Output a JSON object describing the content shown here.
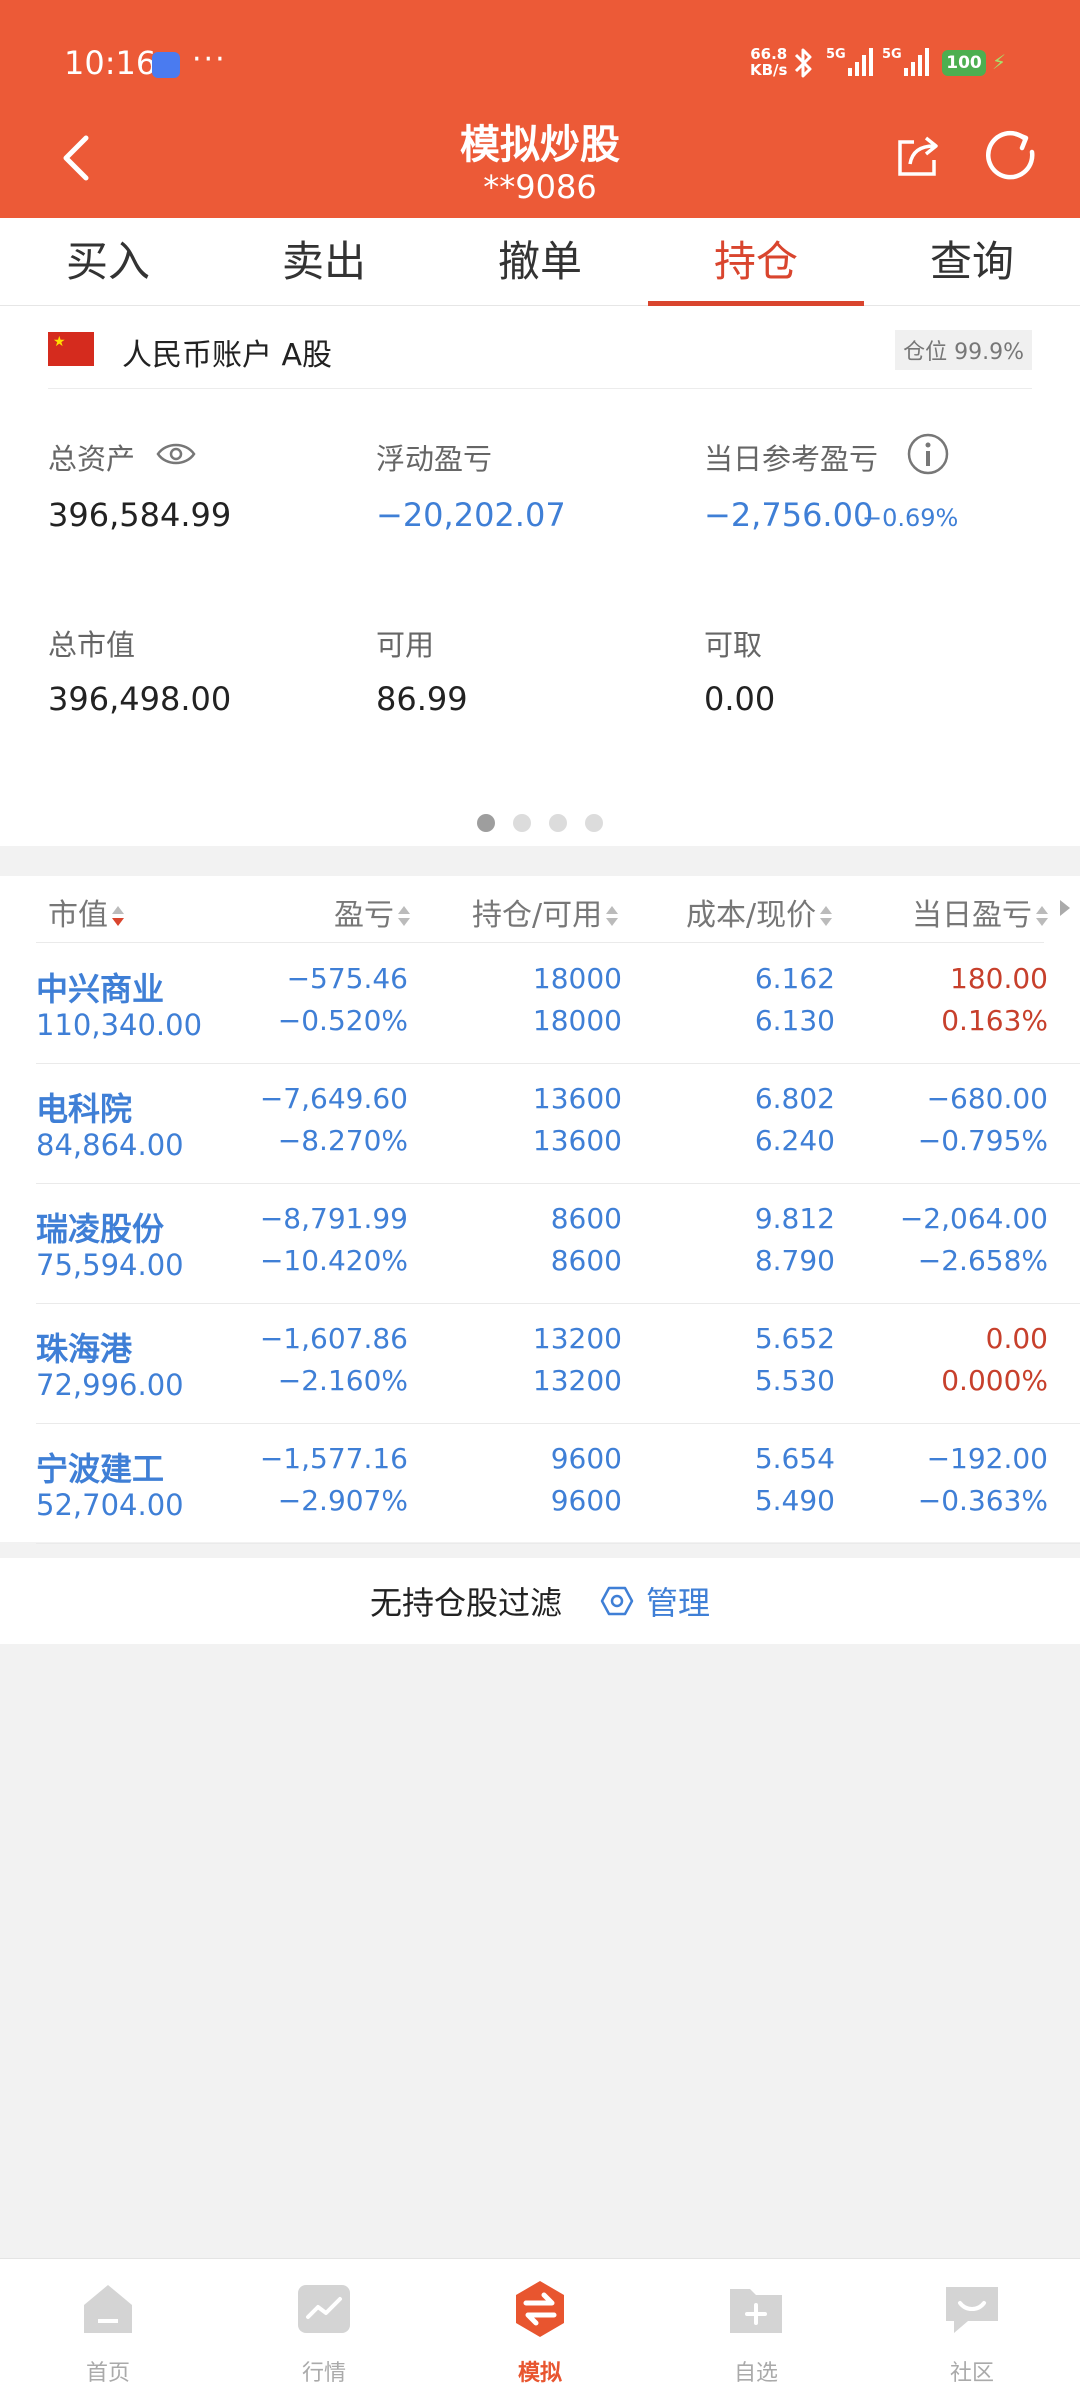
{
  "status": {
    "time": "10:16",
    "more": "···",
    "network_speed_value": "66.8",
    "network_speed_unit": "KB/s",
    "sim1": "5G",
    "sim2": "5G",
    "battery": "100"
  },
  "header": {
    "title": "模拟炒股",
    "account_masked": "**9086"
  },
  "tabs": [
    {
      "label": "买入"
    },
    {
      "label": "卖出"
    },
    {
      "label": "撤单"
    },
    {
      "label": "持仓",
      "active": true
    },
    {
      "label": "查询"
    }
  ],
  "account": {
    "label": "人民币账户 A股",
    "position_badge": "仓位 99.9%",
    "total_assets_label": "总资产",
    "total_assets": "396,584.99",
    "floating_pl_label": "浮动盈亏",
    "floating_pl": "−20,202.07",
    "daily_ref_pl_label": "当日参考盈亏",
    "daily_ref_pl": "−2,756.00",
    "daily_ref_pl_pct": "−0.69%",
    "total_market_value_label": "总市值",
    "total_market_value": "396,498.00",
    "available_label": "可用",
    "available": "86.99",
    "withdrawable_label": "可取",
    "withdrawable": "0.00",
    "page_index": 1,
    "page_count": 4
  },
  "holdings": {
    "columns": [
      "市值",
      "盈亏",
      "持仓/可用",
      "成本/现价",
      "当日盈亏"
    ],
    "rows": [
      {
        "name": "中兴商业",
        "market_value": "110,340.00",
        "pl": "−575.46",
        "pl_pct": "−0.520%",
        "position": "18000",
        "available": "18000",
        "cost": "6.162",
        "price": "6.130",
        "daily_pl": "180.00",
        "daily_pl_pct": "0.163%",
        "daily_color": "red"
      },
      {
        "name": "电科院",
        "market_value": "84,864.00",
        "pl": "−7,649.60",
        "pl_pct": "−8.270%",
        "position": "13600",
        "available": "13600",
        "cost": "6.802",
        "price": "6.240",
        "daily_pl": "−680.00",
        "daily_pl_pct": "−0.795%",
        "daily_color": "blue"
      },
      {
        "name": "瑞凌股份",
        "market_value": "75,594.00",
        "pl": "−8,791.99",
        "pl_pct": "−10.420%",
        "position": "8600",
        "available": "8600",
        "cost": "9.812",
        "price": "8.790",
        "daily_pl": "−2,064.00",
        "daily_pl_pct": "−2.658%",
        "daily_color": "blue"
      },
      {
        "name": "珠海港",
        "market_value": "72,996.00",
        "pl": "−1,607.86",
        "pl_pct": "−2.160%",
        "position": "13200",
        "available": "13200",
        "cost": "5.652",
        "price": "5.530",
        "daily_pl": "0.00",
        "daily_pl_pct": "0.000%",
        "daily_color": "red"
      },
      {
        "name": "宁波建工",
        "market_value": "52,704.00",
        "pl": "−1,577.16",
        "pl_pct": "−2.907%",
        "position": "9600",
        "available": "9600",
        "cost": "5.654",
        "price": "5.490",
        "daily_pl": "−192.00",
        "daily_pl_pct": "−0.363%",
        "daily_color": "blue"
      }
    ]
  },
  "filter": {
    "text": "无持仓股过滤",
    "manage_label": "管理"
  },
  "bottom_nav": [
    {
      "label": "首页"
    },
    {
      "label": "行情"
    },
    {
      "label": "模拟",
      "active": true
    },
    {
      "label": "自选"
    },
    {
      "label": "社区"
    }
  ],
  "colors": {
    "header_bg": "#ec5a37",
    "accent_red": "#d9452e",
    "value_blue": "#3f7fd6",
    "gain_red": "#c7402c"
  }
}
